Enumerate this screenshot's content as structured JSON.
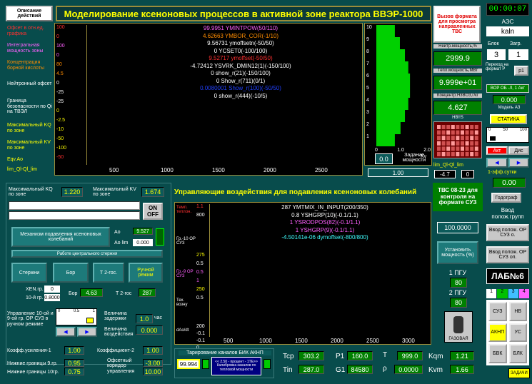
{
  "header": {
    "title": "Моделирование ксеноновых процессов в активной зоне реактора ВВЭР-1000",
    "opisanie": "Описание действий",
    "vyzov": "Вызов формата для просмотра направленных ТВС",
    "clock": "00:00:07",
    "aes": "АЭС",
    "aes_name": "kaln",
    "blok_lbl": "Блок",
    "zagr_lbl": "Загр.",
    "blok": "3",
    "zagr": "1"
  },
  "top_chart": {
    "left_labels": [
      "Офсет в отн.ед. графика",
      "Интегральная мощность зоны",
      "Концентрация борной кислоты",
      "Нейтронный офсет",
      "Граница безопасности по Qi на ТВЭЛ",
      "Максимальный KQ по зоне",
      "Максимальный KV по зоне",
      "Eqv.Ao",
      "lim_Ql-Ql_lim"
    ],
    "scale_rows": [
      [
        "100",
        "100"
      ],
      [
        "0",
        "0"
      ],
      [
        "100",
        "100"
      ],
      [
        "0",
        "0"
      ],
      [
        "80",
        "0"
      ],
      [
        "4.5",
        "0"
      ],
      [
        "0",
        "0"
      ],
      [
        "-25",
        "-25"
      ],
      [
        "-25",
        "-25"
      ],
      [
        "0",
        "0.5"
      ],
      [
        "-2.5",
        "0"
      ],
      [
        "-10",
        "0"
      ],
      [
        "-50",
        "-50"
      ],
      [
        "-100",
        "-50"
      ],
      [
        "-50",
        "-50"
      ]
    ],
    "series_text": [
      {
        "t": "99.9951  YMINTPOW(50/110)",
        "c": "#ff60ff"
      },
      {
        "t": "4.62663  YMBOR_COR(-1/10)",
        "c": "#ff8c00"
      },
      {
        "t": "9.56731  ymoffsetn(-50/50)",
        "c": "#ffffff"
      },
      {
        "t": "0  YCSET0(-100/100)",
        "c": "#ffffff"
      },
      {
        "t": "9.52717  ymoffset(-50/50)",
        "c": "#ff3030"
      },
      {
        "t": "-4.72412  YSVRK_DMIN12(1)(-150/100)",
        "c": "#ffffff"
      },
      {
        "t": "0  show_r(21)(-150/100)",
        "c": "#ffffff"
      },
      {
        "t": "0  Show_r(711)(0/1)",
        "c": "#ffffff"
      },
      {
        "t": "0.0080001  Show_r(100)(-50/50)",
        "c": "#2040ff"
      },
      {
        "t": "0  show_r(444)(-10/5)",
        "c": "#ffffff"
      }
    ],
    "x_ticks": [
      "500",
      "1000",
      "1500",
      "2000",
      "2500"
    ],
    "bar_ticks": [
      "10",
      "9",
      "8",
      "7",
      "6",
      "5",
      "4",
      "3",
      "2",
      "1"
    ],
    "bar_x": [
      "0",
      "1.0",
      "2.0"
    ],
    "bar_kv": "Kv",
    "zadanie": "Задание мощности",
    "zadanie_val": "0.0",
    "power_set": "1.00",
    "ql_lbl": "lim_Ql-Ql_lim",
    "ql_val": "-4.7",
    "ql_val2": "0"
  },
  "right_top": {
    "nejtr_lbl": "Нейтр.мощность,%",
    "nejtr_val": "2999.9",
    "tepl_lbl": "Тепл.мощность,МВт",
    "tepl_val": "9.999e+01",
    "konc_lbl": "Концентр.H3BO3,г/кг",
    "konc_val": "4.627",
    "hbis": "HB!!S"
  },
  "left_mid": {
    "kq_lbl": "Максимальный KQ по зоне",
    "kq": "1.220",
    "kv_lbl": "Максимальный KV по зоне",
    "kv": "1.674",
    "on_off": "ON OFF",
    "mech": "Механизм подавления ксеноновых колебаний",
    "ao_lbl": "Ао",
    "ao_val": "9.527",
    "aolim_lbl": "Ао lim",
    "aolim_val": "0.000",
    "work": "Работе центрального стержня",
    "sterzhni": "Стержни",
    "bor": "Бор",
    "t2": "Т 2-гос.",
    "ruchn": "Ручной режим",
    "xen_lbl": "XEN.гр.",
    "xen_val": "0",
    "gr10_lbl": "10-й гр.",
    "gr10_val": "0.8000",
    "bor_lbl": "Бор",
    "bor_val": "4.63",
    "t2_lbl": "Т 2-гос",
    "t2_val": "287",
    "upr": "Управление 10-ой и 9-ой гр. ОР СУЗ в ручном режиме",
    "slider_ticks": [
      "0",
      "0.5",
      "1"
    ],
    "velich": "Величина задержки",
    "velich_val": "1.0",
    "chas": "час",
    "velich2": "Величина воздействия",
    "velich2_val": "0.000",
    "k1_lbl": "Коэфф.усиления-1",
    "k1": "1.00",
    "k2_lbl": "Коэффициент-2",
    "k2": "1.00",
    "ng9_lbl": "Нижние границы 9.гр.",
    "ng9": "0.95",
    "ng10_lbl": "Нижние границы 10гр.",
    "ng10": "0.75",
    "ofs_lbl": "Офсетный коридор управления",
    "ofs1": "-3.00",
    "ofs2": "10.00"
  },
  "mid_chart": {
    "title": "Управляющие воздействия для подавления ксеноновых колебаний",
    "series_text": [
      {
        "t": "287  YMTMIX_IN_INPUT(200/350)",
        "c": "#ffffff"
      },
      {
        "t": "0.8  YSHGRP(10)(-0.1/1.1)",
        "c": "#ffffff"
      },
      {
        "t": "1  YSRODPOS(82)(-0.1/1.1)",
        "c": "#ff60ff"
      },
      {
        "t": "1  YSHGRP(9)(-0.1/1.1)",
        "c": "#ff60ff"
      },
      {
        "t": "-4.50141e-06  dymoffset(-800/800)",
        "c": "#40ffff"
      }
    ],
    "left_labels": [
      "Темп. теплон.",
      "Гр.-10 ОР СУЗ",
      "Гр.-9 ОР СУЗ",
      "Тех. возну",
      "dAo/dt"
    ],
    "scale": [
      "1.1",
      "800",
      "275",
      "0.5",
      "0.5",
      "1",
      "250",
      "0.5",
      "200",
      "-0.1",
      "-0.1",
      "0"
    ],
    "x_ticks": [
      "500",
      "1000",
      "1500",
      "2000",
      "2500",
      "3000"
    ]
  },
  "tvs_panel": {
    "tvs": "ТВС 08-23 для контроля на формате СУЗ",
    "val": "100.0000",
    "ustanov": "Установить мощность (%)",
    "pgu1": "1 ПГУ",
    "pgu1_v": "80",
    "pgu2": "2 ПГУ",
    "pgu2_v": "80",
    "avar": "ГАЗОВАЯ"
  },
  "bottom": {
    "bik": "Тарирование каналов БИК АКНП",
    "bik_val": "99.994",
    "bik_btn": "<< 2.50 - процент - 1ТЕ>> Калибровка каналов по тепловой мощности",
    "tcp_lbl": "Tcp",
    "tcp": "303.2",
    "p1_lbl": "P1",
    "p1": "160.0",
    "t_lbl": "T",
    "t": "999.0",
    "kqm_lbl": "Kqm",
    "kqm": "1.21",
    "tin_lbl": "Tin",
    "tin": "287.0",
    "g1_lbl": "G1",
    "g1": "84580",
    "rho_lbl": "ρ",
    "rho": "0.0000",
    "kvm_lbl": "Kvm",
    "kvm": "1.66"
  },
  "right_panel": {
    "perehod": "Переход на формат Р",
    "p1": "р1",
    "off": "ВОР ОБ -Л, 1 Акт",
    "model": "Модель АЗ",
    "model_val": "0.000",
    "statika": "СТАТИКА",
    "rule_ticks": [
      "0",
      "50",
      "100"
    ],
    "akt": "Акт",
    "dis": "Дис",
    "kuf": "1-эфф.сутки",
    "kuf_val": "0.00",
    "godograf": "Годограф",
    "vvod": "Ввод полож.групп",
    "vvod1": "Ввод полож. ОР СУЗ о.",
    "vvod2": "Ввод полож. ОР СУЗ оп.",
    "lab": "ЛАБ№6",
    "tabs": [
      "1",
      "2",
      "3",
      "4"
    ],
    "grid": [
      "СУЗ",
      "НВ",
      "АКНП",
      "УС",
      "БВК",
      "БЛК"
    ],
    "zadachi": "ЗАДАЧИ"
  }
}
